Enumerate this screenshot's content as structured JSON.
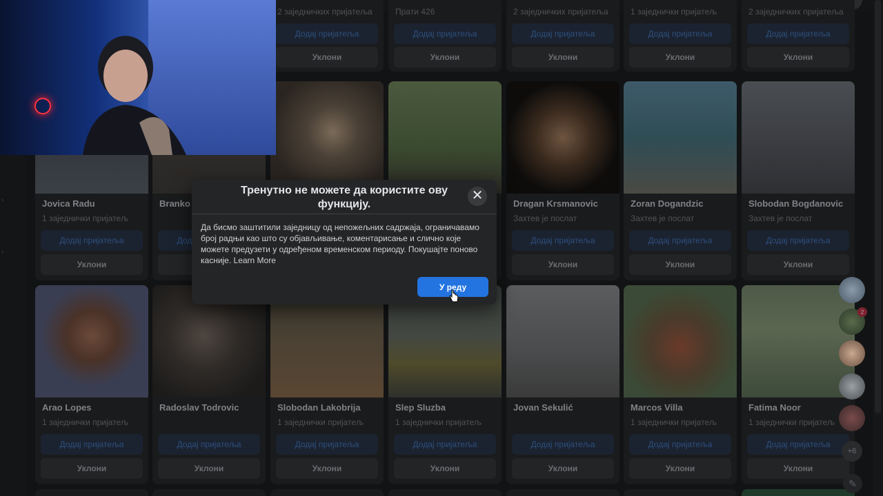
{
  "labels": {
    "add_friend": "Додај пријатеља",
    "remove": "Уклони",
    "request_sent": "Захтев је послат"
  },
  "top_partial_cards": [
    {
      "sub": "2 заједничких пријатеља"
    },
    {
      "sub": "Прати 426"
    },
    {
      "sub": "2 заједничких пријатеља"
    },
    {
      "sub": "1 заједнички пријатељ"
    },
    {
      "sub": "2 заједничких пријатеља"
    }
  ],
  "row1": [
    {
      "name": "Jovica Radu",
      "sub": "1 заједнички пријатељ"
    },
    {
      "name": "Branko",
      "sub": ""
    },
    {
      "name": "",
      "sub": ""
    },
    {
      "name": "",
      "sub": ""
    },
    {
      "name": "Dragan Krsmanovic",
      "sub": "Захтев је послат"
    },
    {
      "name": "Zoran Dogandzic",
      "sub": "Захтев је послат"
    },
    {
      "name": "Slobodan Bogdanovic",
      "sub": "Захтев је послат"
    }
  ],
  "row2": [
    {
      "name": "Arao Lopes",
      "sub": "1 заједнички пријатељ"
    },
    {
      "name": "Radoslav Todrovic",
      "sub": ""
    },
    {
      "name": "Slobodan Lakobrija",
      "sub": "1 заједнички пријатељ"
    },
    {
      "name": "Slep Sluzba",
      "sub": "1 заједнички пријатељ"
    },
    {
      "name": "Jovan Sekulić",
      "sub": ""
    },
    {
      "name": "Marcos Villa",
      "sub": "1 заједнички пријатељ"
    },
    {
      "name": "Fatima Noor",
      "sub": "1 заједнички пријатељ"
    }
  ],
  "modal": {
    "title": "Тренутно не можете да користите ову функцију.",
    "close_glyph": "✕",
    "body": "Да бисмо заштитили заједницу од непожељних садржаја, ограничавамо број радњи као што су објављивање, коментарисање и слично које можете предузети у одређеном временском периоду. Покушајте поново касније. ",
    "learn_more": "Learn More",
    "ok_label": "У реду"
  },
  "chat": {
    "more_label": "+6",
    "badge": "2",
    "compose_glyph": "✎"
  },
  "colors": {
    "primary_blue": "#2374e1",
    "modal_bg": "#242526",
    "page_bg": "#121314"
  }
}
